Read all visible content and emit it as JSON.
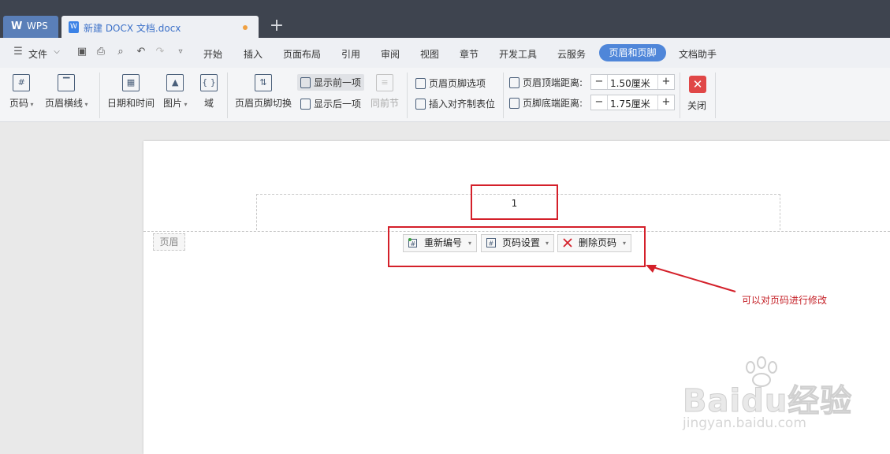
{
  "tabs": {
    "home": {
      "label": "WPS"
    },
    "document": {
      "label": "新建 DOCX 文档.docx"
    },
    "add": {
      "label": "+"
    }
  },
  "menubar": {
    "file": "文件",
    "items": [
      "开始",
      "插入",
      "页面布局",
      "引用",
      "审阅",
      "视图",
      "章节",
      "开发工具",
      "云服务",
      "页眉和页脚",
      "文档助手"
    ],
    "active": "页眉和页脚"
  },
  "ribbon": {
    "page_number": "页码",
    "header_line": "页眉横线",
    "date_time": "日期和时间",
    "picture": "图片",
    "field": "域",
    "switch": "页眉页脚切换",
    "show_prev": "显示前一项",
    "show_next": "显示后一项",
    "same_as_prev": "同前节",
    "hf_options": "页眉页脚选项",
    "insert_align_tab": "插入对齐制表位",
    "header_top_distance": {
      "label": "页眉顶端距离:",
      "value": "1.50厘米"
    },
    "footer_bottom_distance": {
      "label": "页脚底端距离:",
      "value": "1.75厘米"
    },
    "close": "关闭"
  },
  "document": {
    "page_number": "1",
    "header_label": "页眉",
    "popup": {
      "renumber": "重新编号",
      "page_setup": "页码设置",
      "delete": "删除页码"
    },
    "annotation": "可以对页码进行修改"
  },
  "watermark": {
    "brand": "Baidu经验",
    "url": "jingyan.baidu.com"
  },
  "colors": {
    "accent": "#4f86d9",
    "highlight_box": "#d4202a",
    "annotation": "#c41d24",
    "titlebar": "#3e444f"
  }
}
